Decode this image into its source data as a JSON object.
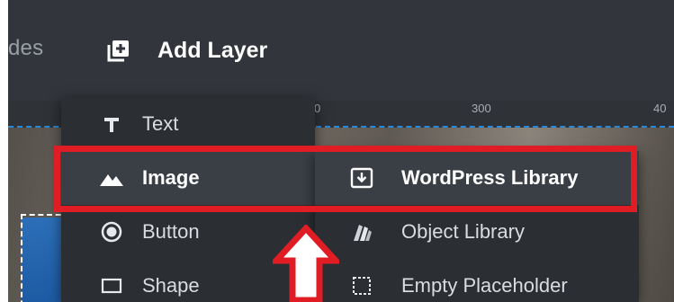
{
  "topbar": {
    "partial_label": "des",
    "add_layer": {
      "label": "Add Layer",
      "icon": "add-layer-icon"
    }
  },
  "ruler": {
    "labels": [
      "0",
      "300",
      "40"
    ]
  },
  "menu": {
    "items": [
      {
        "label": "Text",
        "icon": "text-icon",
        "active": false
      },
      {
        "label": "Image",
        "icon": "image-icon",
        "active": true
      },
      {
        "label": "Button",
        "icon": "button-icon",
        "active": false
      },
      {
        "label": "Shape",
        "icon": "shape-icon",
        "active": false
      }
    ]
  },
  "submenu": {
    "items": [
      {
        "label": "WordPress Library",
        "icon": "import-icon",
        "active": true
      },
      {
        "label": "Object Library",
        "icon": "object-library-icon",
        "active": false
      },
      {
        "label": "Empty Placeholder",
        "icon": "placeholder-icon",
        "active": false
      }
    ]
  },
  "annotation": {
    "highlight_color": "#e01c24",
    "arrow_icon": "up-arrow-icon"
  }
}
